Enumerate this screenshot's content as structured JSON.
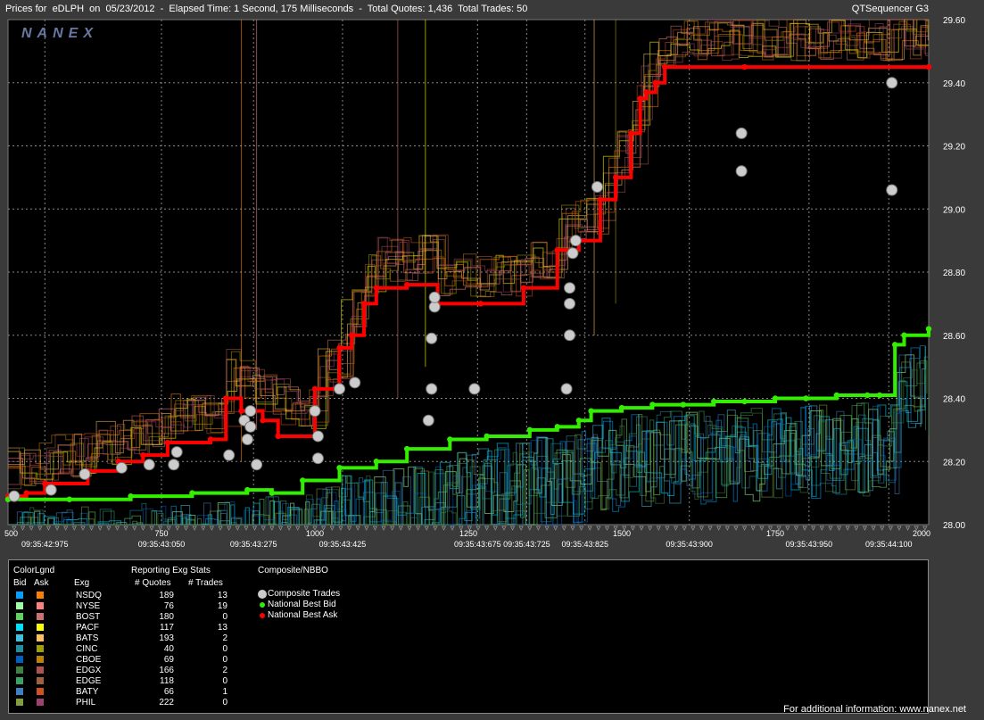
{
  "header": {
    "title": "Prices for  eDLPH  on  05/23/2012  -  Elapsed Time: 1 Second, 175 Milliseconds  -  Total Quotes: 1,436  Total Trades: 50",
    "brand": "QTSequencer G3",
    "watermark": "NANEX"
  },
  "chart_data": {
    "type": "line",
    "title": "",
    "xlim": [
      500,
      2000
    ],
    "ylim": [
      28.0,
      29.6
    ],
    "x_ticks": [
      "500",
      "750",
      "1000",
      "1250",
      "1500",
      "1750",
      "2000"
    ],
    "time_ticks": [
      {
        "x": 560,
        "label": "09:35:42:975"
      },
      {
        "x": 750,
        "label": "09:35:43:050"
      },
      {
        "x": 900,
        "label": "09:35:43:275"
      },
      {
        "x": 1045,
        "label": "09:35:43:425"
      },
      {
        "x": 1265,
        "label": "09:35:43:675"
      },
      {
        "x": 1345,
        "label": "09:35:43:725"
      },
      {
        "x": 1440,
        "label": "09:35:43:825"
      },
      {
        "x": 1610,
        "label": "09:35:43:900"
      },
      {
        "x": 1805,
        "label": "09:35:43:950"
      },
      {
        "x": 1935,
        "label": "09:35:44:100"
      }
    ],
    "y_ticks": [
      "28.00",
      "28.20",
      "28.40",
      "28.60",
      "28.80",
      "29.00",
      "29.20",
      "29.40",
      "29.60"
    ],
    "grid": true,
    "series": [
      {
        "name": "National Best Ask",
        "color": "#ff0000",
        "x": [
          500,
          530,
          560,
          630,
          680,
          720,
          760,
          830,
          855,
          880,
          915,
          940,
          1000,
          1040,
          1060,
          1080,
          1100,
          1150,
          1200,
          1270,
          1340,
          1395,
          1430,
          1465,
          1490,
          1515,
          1530,
          1540,
          1555,
          1570,
          1700,
          2000
        ],
        "y": [
          28.09,
          28.1,
          28.13,
          28.17,
          28.2,
          28.22,
          28.26,
          28.27,
          28.4,
          28.36,
          28.33,
          28.28,
          28.43,
          28.56,
          28.6,
          28.7,
          28.75,
          28.76,
          28.7,
          28.7,
          28.75,
          28.87,
          28.9,
          29.03,
          29.1,
          29.24,
          29.35,
          29.37,
          29.4,
          29.45,
          29.45,
          29.45
        ]
      },
      {
        "name": "National Best Bid",
        "color": "#33ee00",
        "x": [
          500,
          600,
          700,
          800,
          890,
          930,
          980,
          1040,
          1100,
          1150,
          1220,
          1280,
          1350,
          1395,
          1430,
          1450,
          1500,
          1550,
          1600,
          1650,
          1700,
          1750,
          1800,
          1850,
          1900,
          1920,
          1945,
          1960,
          2000
        ],
        "y": [
          28.08,
          28.08,
          28.09,
          28.1,
          28.11,
          28.1,
          28.14,
          28.18,
          28.2,
          28.24,
          28.27,
          28.28,
          28.3,
          28.31,
          28.33,
          28.36,
          28.37,
          28.38,
          28.38,
          28.39,
          28.39,
          28.4,
          28.4,
          28.41,
          28.41,
          28.41,
          28.57,
          28.6,
          28.62
        ]
      }
    ],
    "composite_trades": {
      "name": "Composite Trades",
      "color": "#cccccc",
      "x": [
        510,
        570,
        625,
        685,
        730,
        770,
        775,
        860,
        885,
        890,
        895,
        895,
        905,
        1000,
        1005,
        1005,
        1040,
        1065,
        1185,
        1190,
        1190,
        1195,
        1195,
        1260,
        1410,
        1415,
        1415,
        1415,
        1420,
        1425,
        1460,
        1695,
        1695,
        1940,
        1940
      ],
      "y": [
        28.09,
        28.11,
        28.16,
        28.18,
        28.19,
        28.19,
        28.23,
        28.22,
        28.33,
        28.27,
        28.31,
        28.36,
        28.19,
        28.36,
        28.28,
        28.21,
        28.43,
        28.45,
        28.33,
        28.43,
        28.59,
        28.69,
        28.72,
        28.43,
        28.43,
        28.6,
        28.7,
        28.75,
        28.86,
        28.9,
        29.07,
        29.12,
        29.24,
        29.06,
        29.4
      ]
    }
  },
  "legend": {
    "header_colorlegend": "ColorLgnd",
    "header_bid": "Bid",
    "header_ask": "Ask",
    "header_exg": "Exg",
    "header_stats": "Reporting Exg Stats",
    "header_quotes": "# Quotes",
    "header_trades": "# Trades",
    "header_composite": "Composite/NBBO",
    "exchanges": [
      {
        "name": "NSDQ",
        "quotes": "189",
        "trades": "13",
        "bid": "#00a0ff",
        "ask": "#ff8000"
      },
      {
        "name": "NYSE",
        "quotes": "76",
        "trades": "19",
        "bid": "#a0ffa0",
        "ask": "#ff8080"
      },
      {
        "name": "BOST",
        "quotes": "180",
        "trades": "0",
        "bid": "#60d060",
        "ask": "#d07070"
      },
      {
        "name": "PACF",
        "quotes": "117",
        "trades": "13",
        "bid": "#00e0ff",
        "ask": "#ffff00"
      },
      {
        "name": "BATS",
        "quotes": "193",
        "trades": "2",
        "bid": "#40c0e0",
        "ask": "#ffc060"
      },
      {
        "name": "CINC",
        "quotes": "40",
        "trades": "0",
        "bid": "#2090a0",
        "ask": "#a0a000"
      },
      {
        "name": "CBOE",
        "quotes": "69",
        "trades": "0",
        "bid": "#0060c0",
        "ask": "#c08000"
      },
      {
        "name": "EDGX",
        "quotes": "166",
        "trades": "2",
        "bid": "#408040",
        "ask": "#b05050"
      },
      {
        "name": "EDGE",
        "quotes": "118",
        "trades": "0",
        "bid": "#40a060",
        "ask": "#a06040"
      },
      {
        "name": "BATY",
        "quotes": "66",
        "trades": "1",
        "bid": "#4080c0",
        "ask": "#d05020"
      },
      {
        "name": "PHIL",
        "quotes": "222",
        "trades": "0",
        "bid": "#80a040",
        "ask": "#a04070"
      }
    ],
    "nbbo": [
      {
        "label": "Composite Trades",
        "color": "#cccccc"
      },
      {
        "label": "National Best Bid",
        "color": "#33ee00"
      },
      {
        "label": "National Best Ask",
        "color": "#ff0000"
      }
    ]
  },
  "footer": "For additional information: www.nanex.net"
}
